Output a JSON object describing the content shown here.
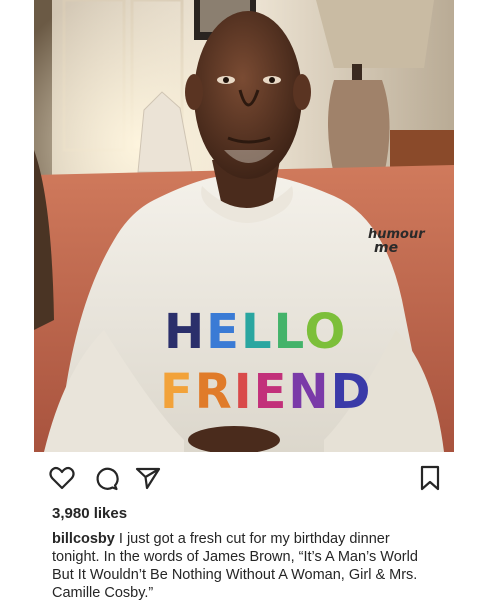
{
  "post": {
    "image": {
      "sweatshirt_brand_line1": "humour",
      "sweatshirt_brand_line2": "me",
      "sweatshirt_line1": "HELLO",
      "sweatshirt_line2": "FRIEND"
    },
    "actions": {
      "like_icon": "heart-icon",
      "comment_icon": "comment-icon",
      "share_icon": "send-icon",
      "save_icon": "bookmark-icon"
    },
    "likes_text": "3,980 likes",
    "caption": {
      "username": "billcosby",
      "text": " I just got a fresh cut for my birthday dinner tonight. In the words of James Brown, “It’s A Man’s World But It Wouldn’t Be Nothing Without A Woman, Girl & Mrs. Camille Cosby.”"
    }
  },
  "colors": {
    "text": "#262626",
    "background": "#ffffff",
    "hello_h": "#2b2f6b",
    "hello_e": "#3a7bd5",
    "hello_l1": "#2aa6a0",
    "hello_l2": "#44b36a",
    "hello_o": "#7cbf3a",
    "friend_f": "#f2a23a",
    "friend_r": "#e07b2a",
    "friend_i": "#d94a4a",
    "friend_e": "#c2307a",
    "friend_n": "#7a3aa8",
    "friend_d": "#3a3aa8"
  }
}
